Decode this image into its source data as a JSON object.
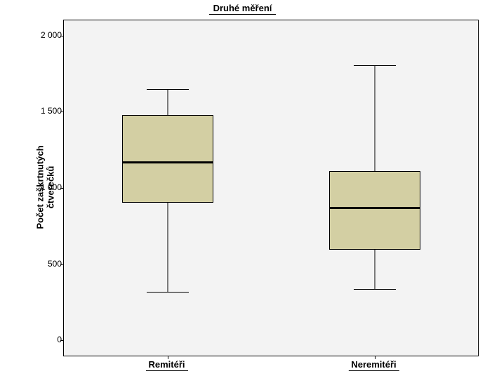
{
  "chart_data": {
    "type": "boxplot",
    "title": "Druhé měření",
    "ylabel": "Počet zaškrtnutých čtverečků",
    "xlabel": "",
    "ylim": [
      -100,
      2100
    ],
    "y_ticks": [
      0,
      500,
      1000,
      1500,
      2000
    ],
    "y_tick_labels": [
      "0",
      "500",
      "1 000",
      "1 500",
      "2 000"
    ],
    "categories": [
      "Remitéři",
      "Neremitéři"
    ],
    "series": [
      {
        "name": "Remitéři",
        "min": 320,
        "q1": 905,
        "median": 1170,
        "q3": 1480,
        "max": 1650
      },
      {
        "name": "Neremitéři",
        "min": 335,
        "q1": 595,
        "median": 870,
        "q3": 1110,
        "max": 1805
      }
    ]
  }
}
